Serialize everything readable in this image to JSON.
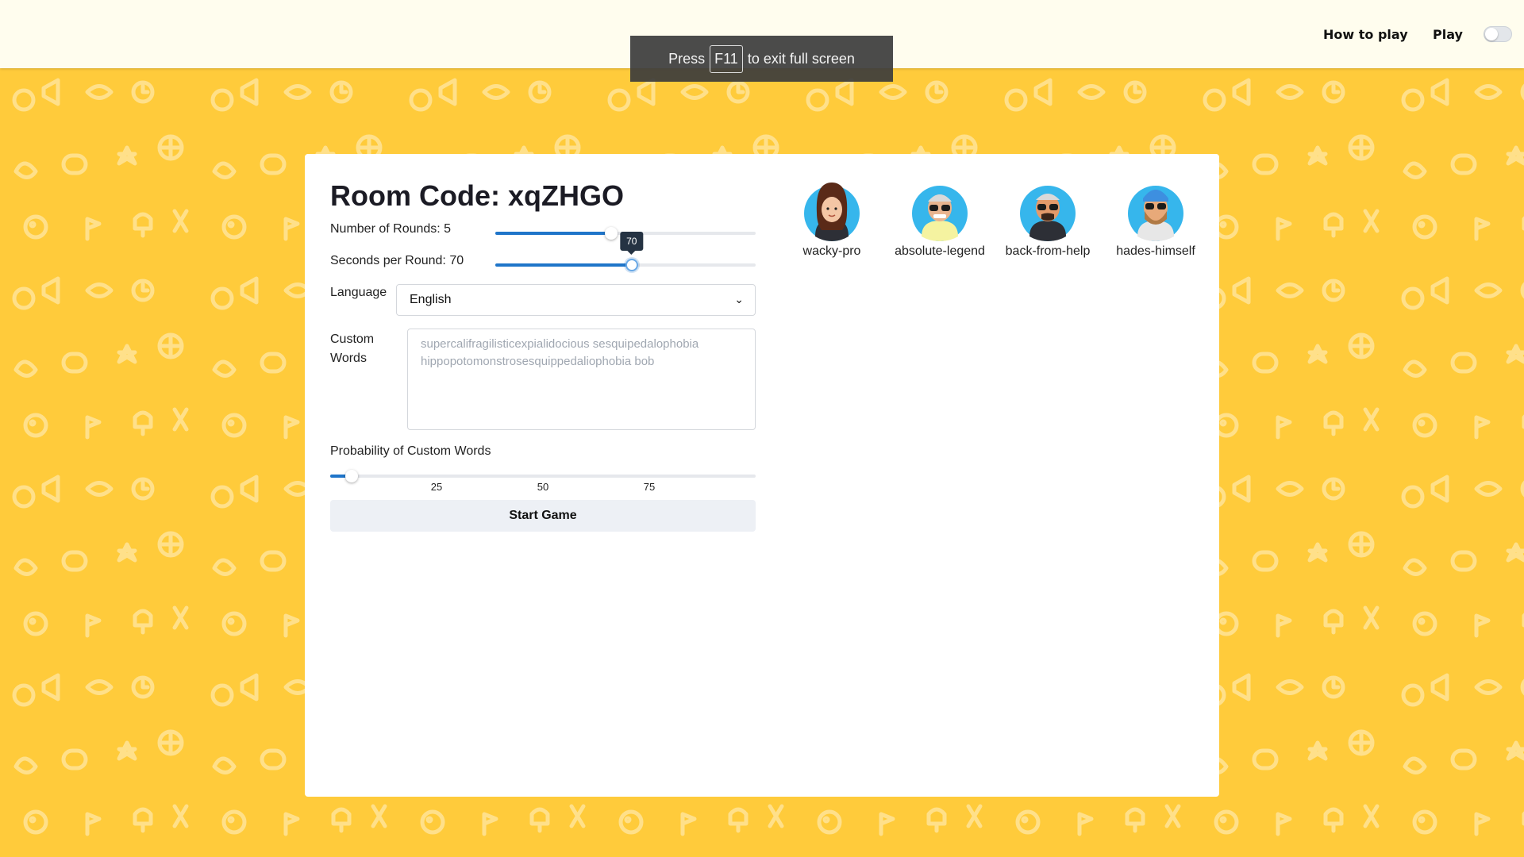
{
  "topbar": {
    "how_to_play": "How to play",
    "play": "Play",
    "toggle_on": false
  },
  "fullscreen_notice": {
    "prefix": "Press",
    "key": "F11",
    "suffix": "to exit full screen"
  },
  "room": {
    "title": "Room Code: xqZHGO"
  },
  "settings": {
    "rounds": {
      "label": "Number of Rounds: 5",
      "value": 5,
      "min": 1,
      "max": 10
    },
    "seconds": {
      "label": "Seconds per Round: 70",
      "value": 70,
      "min": 15,
      "max": 120,
      "tooltip": "70"
    },
    "language": {
      "label": "Language",
      "selected": "English"
    },
    "custom_words": {
      "label_line1": "Custom",
      "label_line2": "Words",
      "placeholder": "supercalifragilisticexpialidocious sesquipedalophobia hippopotomonstrosesquippedaliophobia bob"
    },
    "probability": {
      "label": "Probability of Custom Words",
      "value": 5,
      "min": 0,
      "max": 100,
      "ticks": [
        "25",
        "50",
        "75"
      ]
    },
    "start_button": "Start Game"
  },
  "players": [
    {
      "name": "wacky-pro",
      "avatar": "woman-avatar-icon"
    },
    {
      "name": "absolute-legend",
      "avatar": "old-man-sunglasses-avatar-icon"
    },
    {
      "name": "back-from-help",
      "avatar": "man-sunglasses-avatar-icon"
    },
    {
      "name": "hades-himself",
      "avatar": "bearded-man-beanie-avatar-icon"
    }
  ],
  "colors": {
    "background": "#ffcb3b",
    "accent": "#1f75c9",
    "avatar_bg": "#36b6ec"
  }
}
